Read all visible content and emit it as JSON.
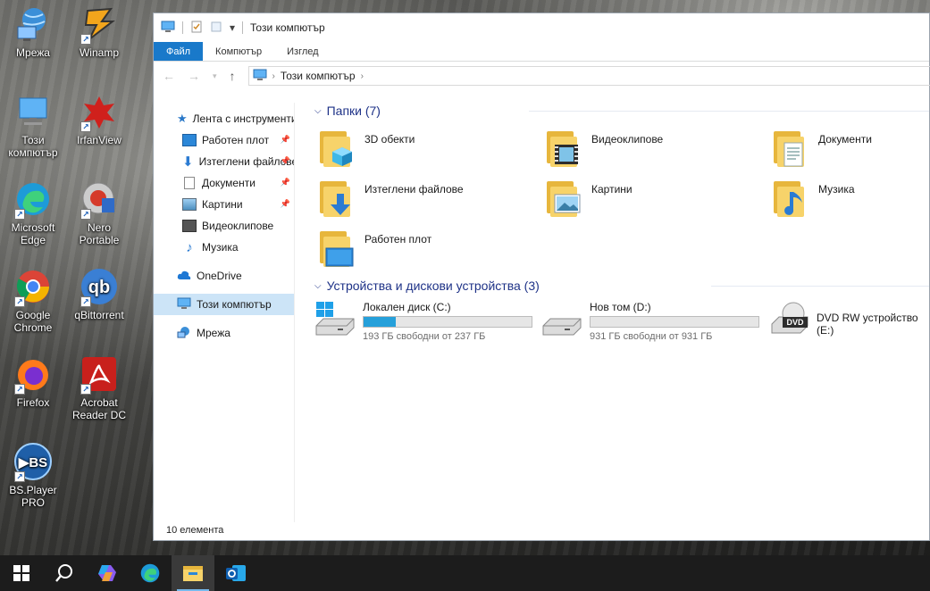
{
  "desktop": {
    "icons": [
      {
        "label": "Мрежа"
      },
      {
        "label": "Winamp"
      },
      {
        "label": "Този компютър"
      },
      {
        "label": "IrfanView"
      },
      {
        "label": "Microsoft Edge"
      },
      {
        "label": "Nero Portable"
      },
      {
        "label": "Google Chrome"
      },
      {
        "label": "qBittorrent"
      },
      {
        "label": "Firefox"
      },
      {
        "label": "Acrobat Reader DC"
      },
      {
        "label": "BS.Player PRO"
      }
    ]
  },
  "window": {
    "title": "Този компютър",
    "ribbon_tabs": [
      "Файл",
      "Компютър",
      "Изглед"
    ],
    "address": {
      "location": "Този компютър"
    },
    "nav_pane": {
      "quick_access": "Лента с инструменти",
      "items": [
        "Работен плот",
        "Изтеглени файлове",
        "Документи",
        "Картини",
        "Видеоклипове",
        "Музика"
      ],
      "onedrive": "OneDrive",
      "this_pc": "Този компютър",
      "network": "Мрежа"
    },
    "folders_header": "Папки (7)",
    "folders": [
      "3D обекти",
      "Видеоклипове",
      "Документи",
      "Изтеглени файлове",
      "Картини",
      "Музика",
      "Работен плот"
    ],
    "devices_header": "Устройства и дискови устройства (3)",
    "drives": [
      {
        "name": "Локален диск (C:)",
        "free": "193 ГБ свободни от 237 ГБ",
        "used_fraction": 0.19
      },
      {
        "name": "Нов том (D:)",
        "free": "931 ГБ свободни от 931 ГБ",
        "used_fraction": 0.0
      },
      {
        "name": "DVD RW устройство (E:)",
        "badge": "DVD"
      }
    ],
    "status": "10 елемента"
  },
  "colors": {
    "accent": "#1979ca",
    "drive_fill": "#26a0da",
    "header_text": "#1e3287",
    "selection": "#cce4f7"
  }
}
